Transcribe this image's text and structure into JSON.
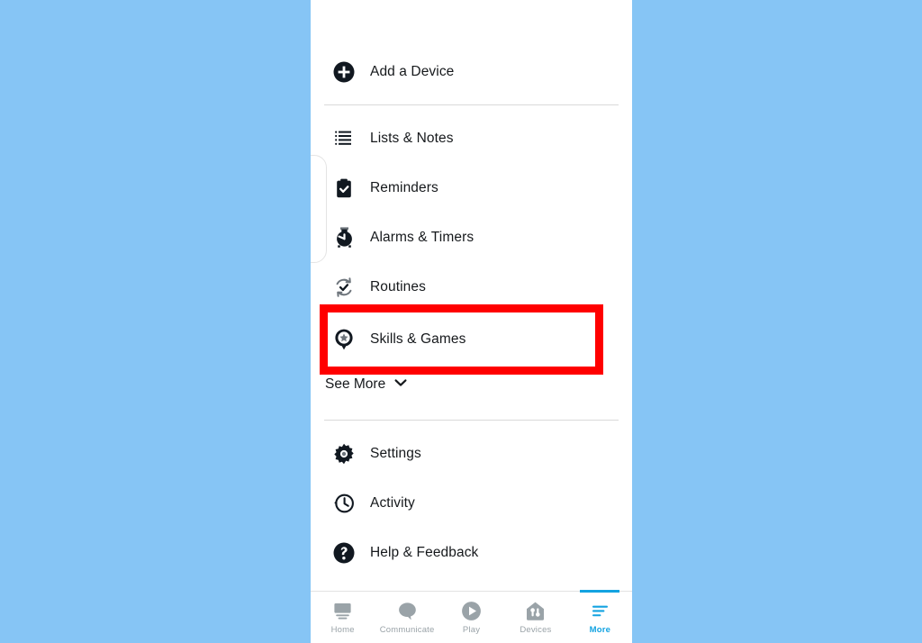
{
  "app": {
    "background_color": "#86c5f5",
    "panel_color": "#ffffff",
    "accent_color": "#13a3e1",
    "highlight_color": "#ff0000"
  },
  "menu": {
    "items": [
      {
        "label": "Add a Device",
        "icon": "plus-circle-icon"
      },
      {
        "label": "Lists & Notes",
        "icon": "list-lines-icon"
      },
      {
        "label": "Reminders",
        "icon": "clipboard-check-icon"
      },
      {
        "label": "Alarms & Timers",
        "icon": "alarm-clock-icon"
      },
      {
        "label": "Routines",
        "icon": "refresh-check-icon"
      },
      {
        "label": "Skills & Games",
        "icon": "pin-star-icon"
      },
      {
        "label": "Settings",
        "icon": "gear-icon"
      },
      {
        "label": "Activity",
        "icon": "clock-history-icon"
      },
      {
        "label": "Help & Feedback",
        "icon": "question-circle-icon"
      }
    ],
    "see_more_label": "See More",
    "see_more_icon": "chevron-down-icon"
  },
  "highlight": {
    "target_label": "Skills & Games",
    "color": "#ff0000"
  },
  "tab_bar": {
    "tabs": [
      {
        "label": "Home",
        "icon": "echo-show-icon",
        "active": false
      },
      {
        "label": "Communicate",
        "icon": "speech-bubble-icon",
        "active": false
      },
      {
        "label": "Play",
        "icon": "play-circle-icon",
        "active": false
      },
      {
        "label": "Devices",
        "icon": "house-toggle-icon",
        "active": false
      },
      {
        "label": "More",
        "icon": "hamburger-lines-icon",
        "active": true
      }
    ]
  }
}
